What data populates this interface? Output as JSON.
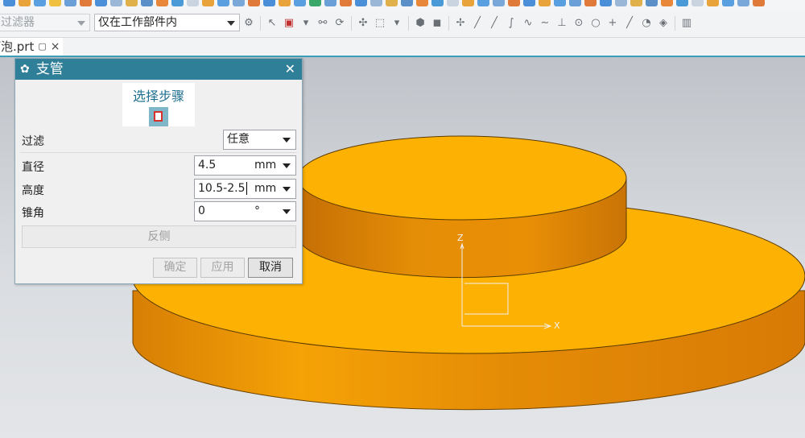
{
  "toolbar": {
    "filter_combo": {
      "value": "过滤器"
    },
    "scope_combo": {
      "value": "仅在工作部件内"
    }
  },
  "document_tab": {
    "name": "灯泡.prt"
  },
  "dialog": {
    "title": "支管",
    "step": {
      "label": "选择步骤"
    },
    "filter": {
      "label": "过滤",
      "value": "任意"
    },
    "diameter": {
      "label": "直径",
      "value": "4.5",
      "unit": "mm"
    },
    "height": {
      "label": "高度",
      "value": "10.5-2.5",
      "unit": "mm"
    },
    "taper": {
      "label": "锥角",
      "value": "0",
      "unit": "°"
    },
    "reverse_label": "反侧",
    "ok_label": "确定",
    "apply_label": "应用",
    "cancel_label": "取消"
  },
  "viewport": {
    "axis_z": "Z",
    "axis_x": "X",
    "model_color": "#fdb103",
    "model_side_color": "#e08a05"
  }
}
